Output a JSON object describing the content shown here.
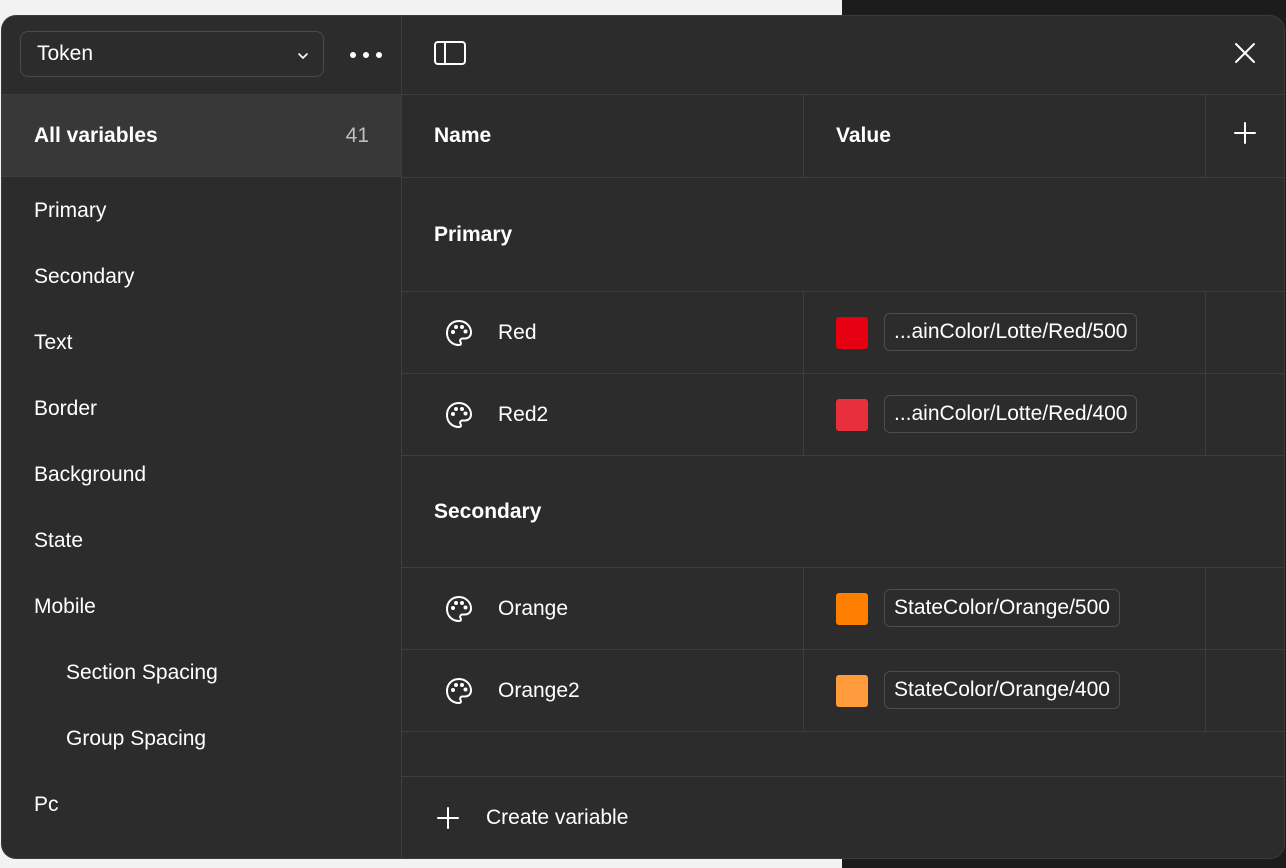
{
  "header": {
    "collection_select": "Token",
    "more_icon": "more-horizontal-icon",
    "sidebar_toggle_icon": "sidebar-panel-icon",
    "close_icon": "close-icon"
  },
  "sidebar": {
    "all_variables": {
      "label": "All variables",
      "count": "41"
    },
    "groups": [
      {
        "label": "Primary",
        "indent": false
      },
      {
        "label": "Secondary",
        "indent": false
      },
      {
        "label": "Text",
        "indent": false
      },
      {
        "label": "Border",
        "indent": false
      },
      {
        "label": "Background",
        "indent": false
      },
      {
        "label": "State",
        "indent": false
      },
      {
        "label": "Mobile",
        "indent": false
      },
      {
        "label": "Section Spacing",
        "indent": true
      },
      {
        "label": "Group Spacing",
        "indent": true
      },
      {
        "label": "Pc",
        "indent": false
      }
    ]
  },
  "table": {
    "col_name": "Name",
    "col_value": "Value",
    "add_icon": "plus-icon",
    "sections": [
      {
        "title": "Primary",
        "rows": [
          {
            "name": "Red",
            "color": "#e60012",
            "alias": "...ainColor/Lotte/Red/500",
            "icon": "palette-icon"
          },
          {
            "name": "Red2",
            "color": "#e8303d",
            "alias": "...ainColor/Lotte/Red/400",
            "icon": "palette-icon"
          }
        ]
      },
      {
        "title": "Secondary",
        "rows": [
          {
            "name": "Orange",
            "color": "#ff8000",
            "alias": "StateColor/Orange/500",
            "icon": "palette-icon"
          },
          {
            "name": "Orange2",
            "color": "#ff9b3d",
            "alias": "StateColor/Orange/400",
            "icon": "palette-icon"
          }
        ]
      }
    ]
  },
  "footer": {
    "create_label": "Create variable"
  },
  "colors": {
    "panel_bg": "#2c2c2c",
    "selected_bg": "#383838",
    "divider": "#3d3d3d"
  }
}
